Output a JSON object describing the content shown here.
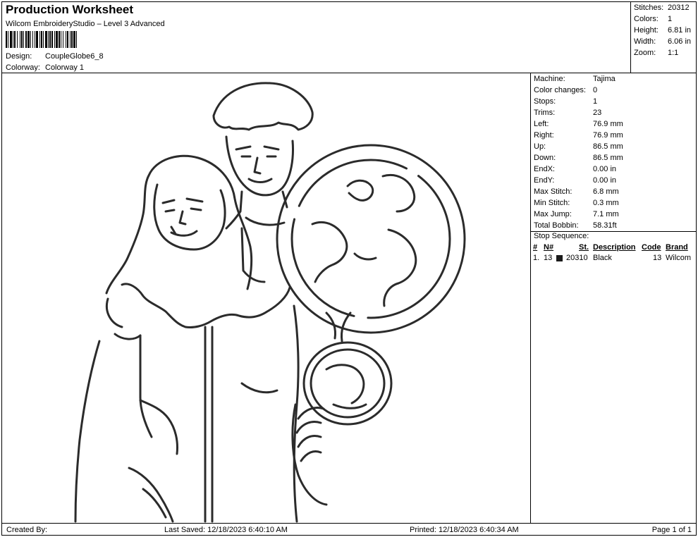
{
  "header": {
    "title": "Production Worksheet",
    "subtitle": "Wilcom EmbroideryStudio – Level 3 Advanced",
    "design_label": "Design:",
    "design_value": "CoupleGlobe6_8",
    "colorway_label": "Colorway:",
    "colorway_value": "Colorway 1"
  },
  "stats": [
    {
      "label": "Stitches:",
      "value": "20312"
    },
    {
      "label": "Colors:",
      "value": "1"
    },
    {
      "label": "Height:",
      "value": "6.81 in"
    },
    {
      "label": "Width:",
      "value": "6.06 in"
    },
    {
      "label": "Zoom:",
      "value": "1:1"
    }
  ],
  "machine_info": [
    {
      "label": "Machine:",
      "value": "Tajima"
    },
    {
      "label": "Color changes:",
      "value": "0"
    },
    {
      "label": "Stops:",
      "value": "1"
    },
    {
      "label": "Trims:",
      "value": "23"
    },
    {
      "label": "Left:",
      "value": "76.9 mm"
    },
    {
      "label": "Right:",
      "value": "76.9 mm"
    },
    {
      "label": "Up:",
      "value": "86.5 mm"
    },
    {
      "label": "Down:",
      "value": "86.5 mm"
    },
    {
      "label": "EndX:",
      "value": "0.00 in"
    },
    {
      "label": "EndY:",
      "value": "0.00 in"
    },
    {
      "label": "Max Stitch:",
      "value": "6.8 mm"
    },
    {
      "label": "Min Stitch:",
      "value": "0.3 mm"
    },
    {
      "label": "Max Jump:",
      "value": "7.1 mm"
    },
    {
      "label": "Total Bobbin:",
      "value": "58.31ft"
    }
  ],
  "stop_sequence": {
    "title": "Stop Sequence:",
    "headers": {
      "num": "#",
      "n": "N#",
      "st": "St.",
      "description": "Description",
      "code": "Code",
      "brand": "Brand"
    },
    "rows": [
      {
        "num": "1.",
        "n": "13",
        "swatch_color": "#1a1a1a",
        "st": "20310",
        "description": "Black",
        "code": "13",
        "brand": "Wilcom"
      }
    ]
  },
  "footer": {
    "created_by": "Created By:",
    "last_saved": "Last Saved: 12/18/2023 6:40:10 AM",
    "printed": "Printed: 12/18/2023 6:40:34 AM",
    "page": "Page 1 of 1"
  }
}
